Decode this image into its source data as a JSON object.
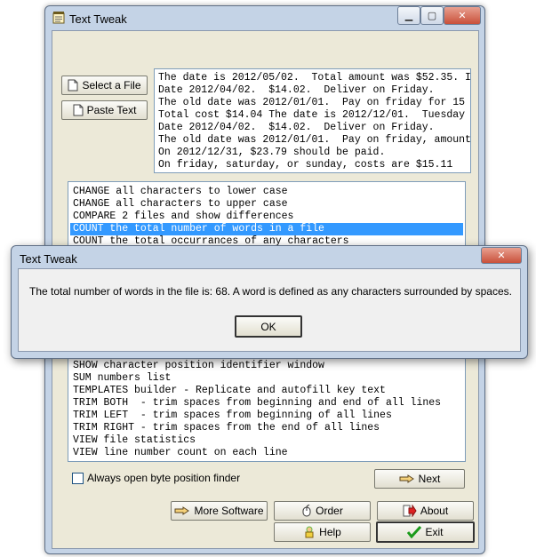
{
  "window": {
    "title": "Text Tweak",
    "minimize_glyph": "▁",
    "maximize_glyph": "▢",
    "close_glyph": "✕"
  },
  "buttons": {
    "select_file": "Select a File",
    "paste_text": "Paste Text",
    "next": "Next",
    "more_software": "More Software",
    "order": "Order",
    "about": "About",
    "help": "Help",
    "exit": "Exit"
  },
  "text_lines": [
    "The date is 2012/05/02.  Total amount was $52.35. I",
    "Date 2012/04/02.  $14.02.  Deliver on Friday.",
    "The old date was 2012/01/01.  Pay on friday for 15",
    "Total cost $14.04 The date is 2012/12/01.  Tuesday",
    "Date 2012/04/02.  $14.02.  Deliver on Friday.",
    "The old date was 2012/01/01.  Pay on friday, amount",
    "On 2012/12/31, $23.79 should be paid.",
    "On friday, saturday, or sunday, costs are $15.11"
  ],
  "list_items_top": [
    "CHANGE all characters to lower case",
    "CHANGE all characters to upper case",
    "COMPARE 2 files and show differences",
    "COUNT the total number of words in a file",
    "COUNT the total occurrances of any characters"
  ],
  "selected_item": "COUNT the total number of words in a file",
  "list_items_bottom": [
    "SHOW character position identifier window",
    "SUM numbers list",
    "TEMPLATES builder - Replicate and autofill key text",
    "TRIM BOTH  - trim spaces from beginning and end of all lines",
    "TRIM LEFT  - trim spaces from beginning of all lines",
    "TRIM RIGHT - trim spaces from the end of all lines",
    "VIEW file statistics",
    "VIEW line number count on each line"
  ],
  "checkbox_label": "Always open byte position finder",
  "dialog": {
    "title": "Text Tweak",
    "message": "The total number of words in the file is: 68. A word is defined as any characters surrounded by spaces.",
    "ok": "OK",
    "close_glyph": "✕"
  }
}
